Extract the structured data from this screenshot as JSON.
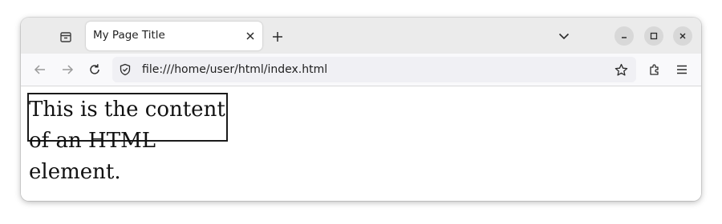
{
  "tab": {
    "title": "My Page Title"
  },
  "address_bar": {
    "url": "file:///home/user/html/index.html"
  },
  "page": {
    "content_text": "This is the content of an HTML element."
  }
}
